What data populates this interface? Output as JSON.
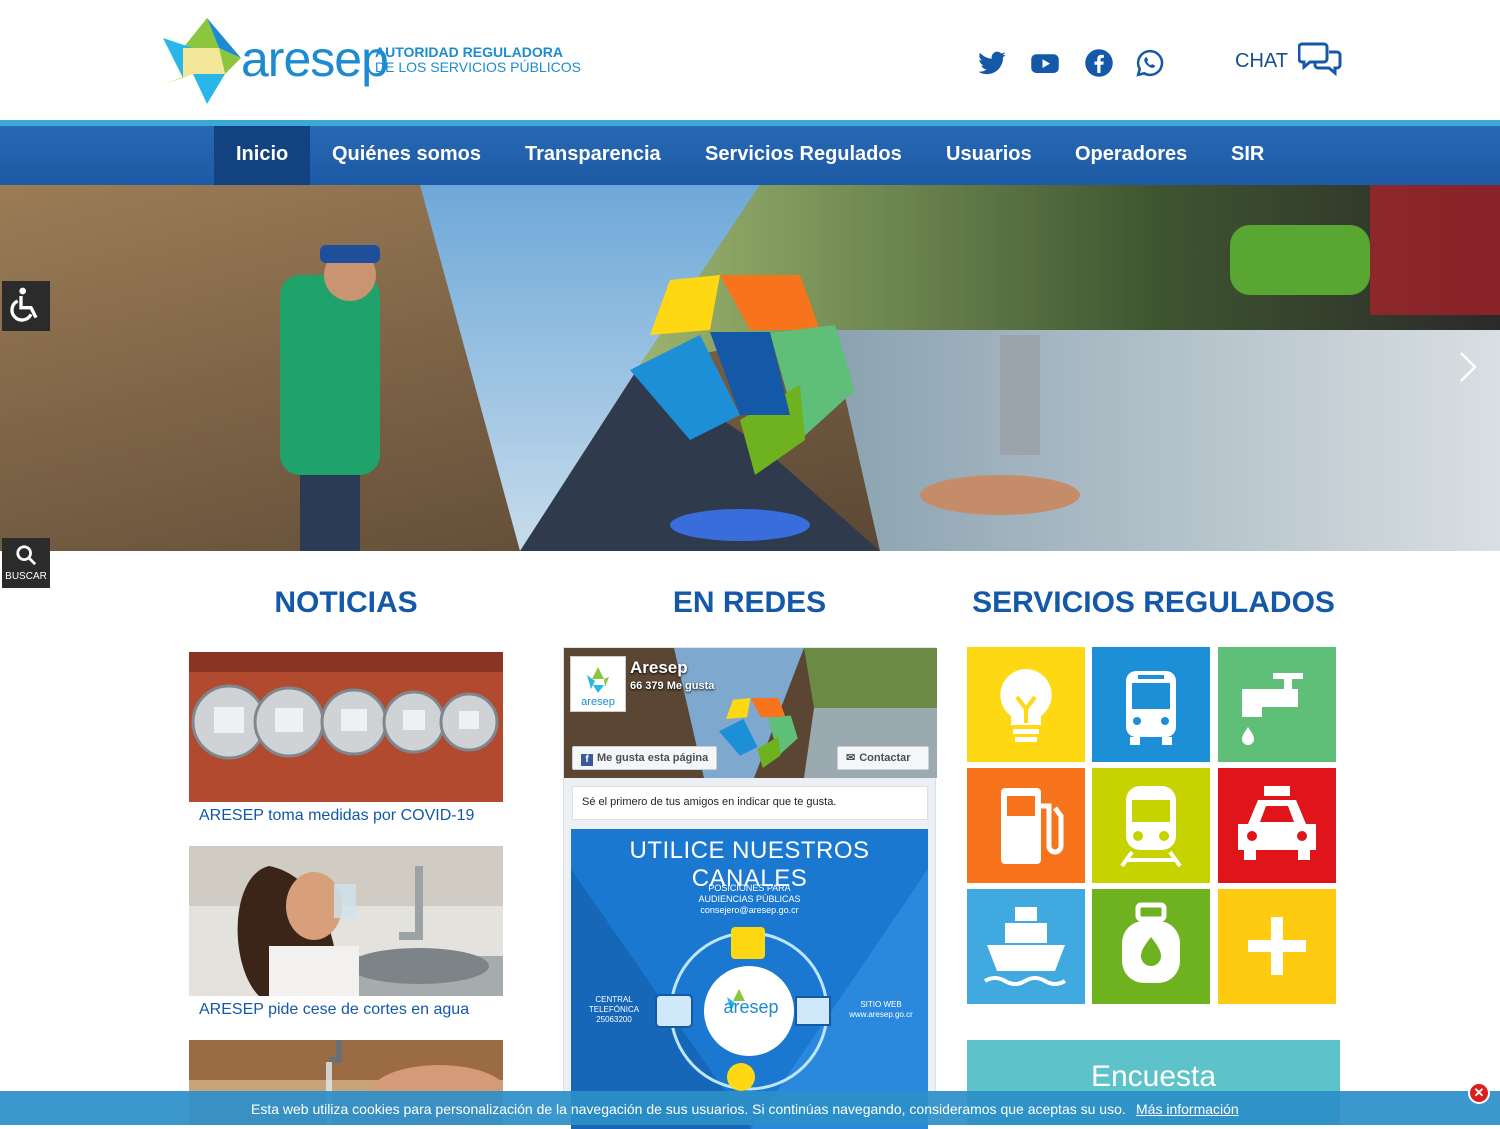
{
  "brand": {
    "name": "aresep",
    "subtitle_line1": "AUTORIDAD REGULADORA",
    "subtitle_line2": "DE LOS SERVICIOS PÚBLICOS"
  },
  "header": {
    "social_icons": [
      "twitter-icon",
      "youtube-icon",
      "facebook-icon",
      "whatsapp-icon"
    ],
    "chat_label": "CHAT"
  },
  "nav": {
    "items": [
      "Inicio",
      "Quiénes somos",
      "Transparencia",
      "Servicios Regulados",
      "Usuarios",
      "Operadores",
      "SIR"
    ],
    "active": "Inicio"
  },
  "side_tools": {
    "search_label": "BUSCAR"
  },
  "sections": {
    "news_title": "NOTICIAS",
    "social_title": "EN REDES",
    "services_title": "SERVICIOS REGULADOS"
  },
  "news": [
    {
      "caption": "ARESEP toma medidas por COVID-19"
    },
    {
      "caption": "ARESEP pide cese de cortes en agua"
    }
  ],
  "facebook": {
    "page_name": "Aresep",
    "likes": "66 379 Me gusta",
    "like_button": "Me gusta esta página",
    "contact_button": "Contactar",
    "friends_text": "Sé el primero de tus amigos en indicar que te gusta.",
    "post": {
      "headline": "UTILICE NUESTROS CANALES",
      "item1_line1": "POSICIONES PARA",
      "item1_line2": "AUDIENCIAS PÚBLICAS",
      "item1_line3": "consejero@aresep.go.cr",
      "phone_line1": "CENTRAL",
      "phone_line2": "TELEFÓNICA",
      "phone_line3": "25063200",
      "web_line1": "SITIO WEB",
      "web_line2": "www.aresep.go.cr",
      "center_logo": "aresep"
    }
  },
  "services": {
    "tiles": [
      {
        "name": "electricidad",
        "icon": "lightbulb-icon",
        "color": "#ffd814"
      },
      {
        "name": "autobus",
        "icon": "bus-icon",
        "color": "#1c8fd6"
      },
      {
        "name": "agua",
        "icon": "water-tap-icon",
        "color": "#5fbf78"
      },
      {
        "name": "combustibles",
        "icon": "fuel-pump-icon",
        "color": "#f7731c"
      },
      {
        "name": "tren",
        "icon": "train-icon",
        "color": "#c6d300"
      },
      {
        "name": "taxi",
        "icon": "taxi-icon",
        "color": "#e0141b"
      },
      {
        "name": "cabotaje",
        "icon": "ship-icon",
        "color": "#3fa9e0"
      },
      {
        "name": "gas",
        "icon": "gas-cylinder-icon",
        "color": "#6fb21f"
      },
      {
        "name": "mas",
        "icon": "plus-icon",
        "color": "#ffcb10"
      }
    ],
    "survey_label": "Encuesta"
  },
  "cookie": {
    "text": "Esta web utiliza cookies para personalización de la navegación de sus usuarios. Si continúas navegando, consideramos que aceptas su uso.",
    "link": "Más información",
    "close": "✕"
  }
}
